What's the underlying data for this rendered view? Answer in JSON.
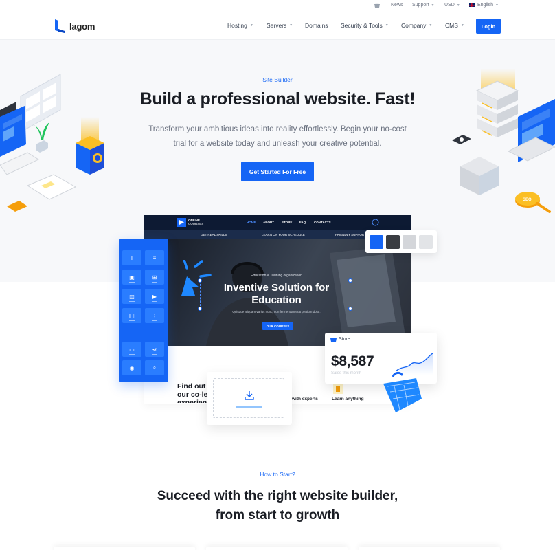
{
  "topbar": {
    "news": "News",
    "support": "Support",
    "currency": "USD",
    "language": "English"
  },
  "brand": {
    "name": "lagom"
  },
  "nav": {
    "items": [
      "Hosting",
      "Servers",
      "Domains",
      "Security & Tools",
      "Company",
      "CMS"
    ],
    "dropdowns": [
      true,
      true,
      false,
      true,
      true,
      true
    ],
    "login": "Login"
  },
  "hero": {
    "eyebrow": "Site Builder",
    "title": "Build a professional website. Fast!",
    "description": "Transform your ambitious ideas into reality effortlessly. Begin your no-cost trial for a website today and unleash your creative potential.",
    "cta": "Get Started For Free"
  },
  "mockup": {
    "brand_line1": "ONLINE",
    "brand_line2": "COURSES",
    "menu": [
      "HOME",
      "ABOUT",
      "STORE",
      "FAQ",
      "CONTACTS"
    ],
    "sub_items": [
      "GET REAL SKILLS",
      "LEARN ON YOUR SCHEDULE",
      "FRIENDLY SUPPORT"
    ],
    "caption": "Education & Training organization",
    "headline": "Inventive Solution for Education",
    "subtext": "Quisque aliquam varius nunc, non fermentum erat pretium dolor.",
    "button": "OUR COURSES",
    "find_out": "Find out our co-le experienc",
    "feature1": "with experts",
    "feature2": "Learn anything"
  },
  "store_card": {
    "label": "Store",
    "value": "$8,587",
    "sub": "Sales this month"
  },
  "swatch_colors": [
    "#1565f5",
    "#3a3d42",
    "#d4d6da",
    "#e2e4e7"
  ],
  "section2": {
    "eyebrow": "How to Start?",
    "title_line1": "Succeed with the right website builder,",
    "title_line2": "from start to growth"
  },
  "icons": {
    "tools": [
      "text-icon",
      "paragraph-icon",
      "image-icon",
      "grid-icon",
      "gallery-icon",
      "video-icon",
      "embed-icon",
      "divider-icon",
      "button-icon",
      "share-icon",
      "map-pin-icon",
      "search-icon"
    ]
  },
  "colors": {
    "accent": "#1565f5",
    "hero_bg": "#f7f8fa",
    "text_dark": "#1a1d24",
    "text_muted": "#6b7280"
  }
}
